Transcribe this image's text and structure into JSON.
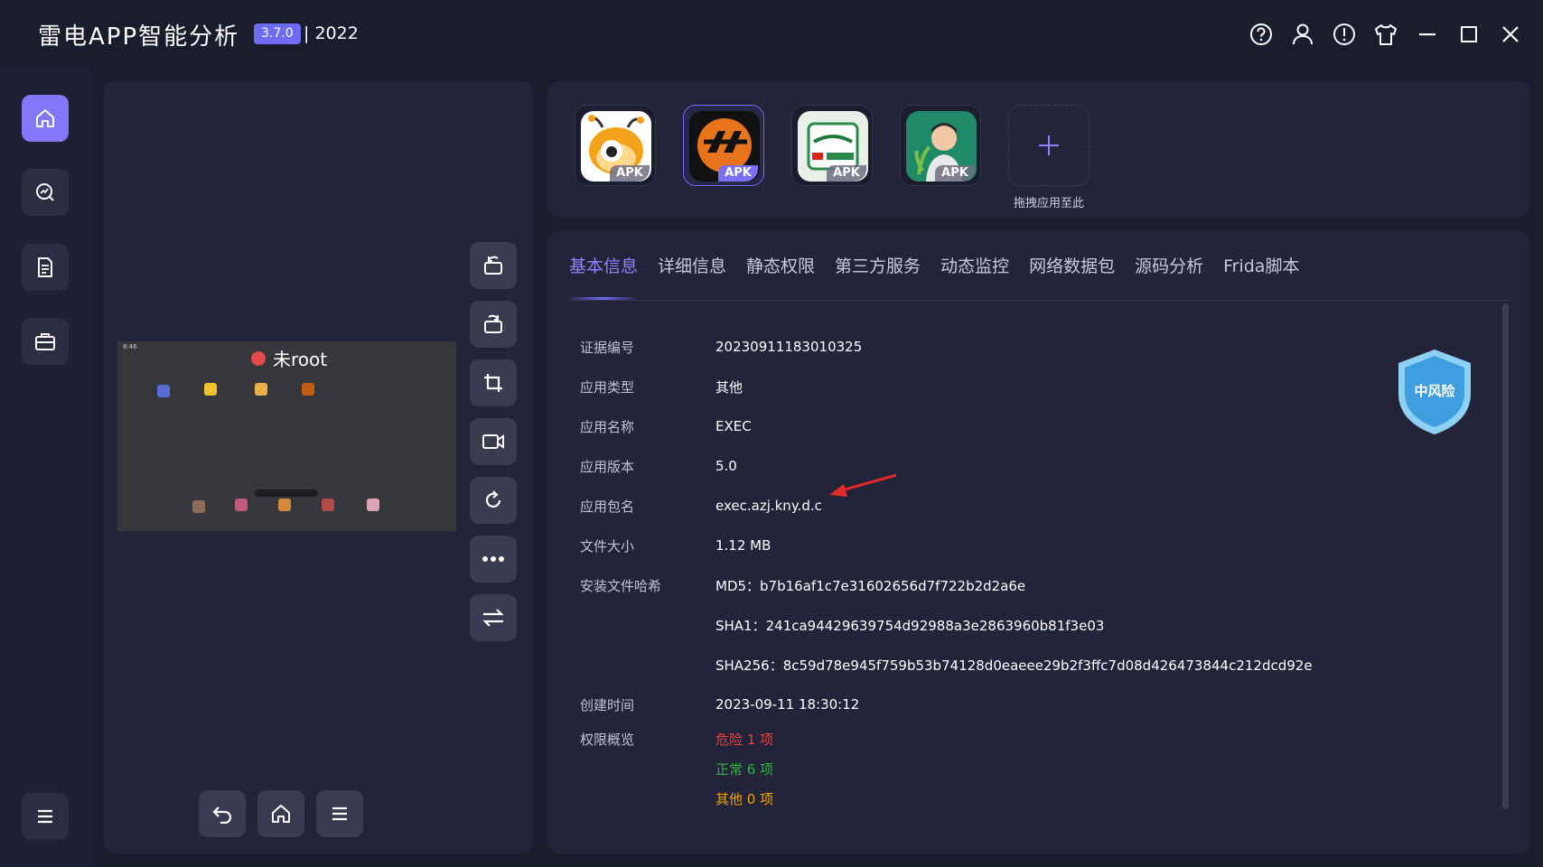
{
  "titlebar": {
    "app_name": "雷电APP智能分析",
    "version": "3.7.0",
    "year": "| 2022",
    "icons": [
      "help-icon",
      "user-icon",
      "alert-icon",
      "shirt-icon",
      "minimize-icon",
      "maximize-icon",
      "close-icon"
    ]
  },
  "sidebar": {
    "items": [
      "home-icon",
      "analytics-icon",
      "document-icon",
      "toolbox-icon"
    ],
    "menu_icon": "menu-icon"
  },
  "device": {
    "root_status": "未root",
    "status_time": "8:46",
    "tools": [
      "rotate-left-icon",
      "rotate-right-icon",
      "crop-icon",
      "record-icon",
      "refresh-icon",
      "more-icon",
      "swap-icon"
    ],
    "nav": [
      "back-icon",
      "home-icon",
      "menu-icon"
    ]
  },
  "apps": {
    "items": [
      {
        "tag": "APK",
        "icon": "ant-mascot-icon"
      },
      {
        "tag": "APK",
        "icon": "exec-logo-icon"
      },
      {
        "tag": "APK",
        "icon": "nutrient-expert-maize-icon"
      },
      {
        "tag": "APK",
        "icon": "man-with-plant-icon"
      }
    ],
    "add_label": "拖拽应用至此"
  },
  "tabs": [
    "基本信息",
    "详细信息",
    "静态权限",
    "第三方服务",
    "动态监控",
    "网络数据包",
    "源码分析",
    "Frida脚本"
  ],
  "info": {
    "cert_label": "证据编号",
    "cert_value": "20230911183010325",
    "type_label": "应用类型",
    "type_value": "其他",
    "name_label": "应用名称",
    "name_value": "EXEC",
    "version_label": "应用版本",
    "version_value": "5.0",
    "package_label": "应用包名",
    "package_value": "exec.azj.kny.d.c",
    "size_label": "文件大小",
    "size_value": "1.12 MB",
    "hash_label": "安装文件哈希",
    "md5": "MD5：b7b16af1c7e31602656d7f722b2d2a6e",
    "sha1": "SHA1：241ca94429639754d92988a3e2863960b81f3e03",
    "sha256": "SHA256：8c59d78e945f759b53b74128d0eaeee29b2f3ffc7d08d426473844c212dcd92e",
    "created_label": "创建时间",
    "created_value": "2023-09-11 18:30:12",
    "perm_label": "权限概览",
    "perm_danger": "危险 1 项",
    "perm_normal": "正常 6 项",
    "perm_other": "其他 0 项"
  },
  "risk": {
    "label": "中风险"
  },
  "colors": {
    "accent": "#6f6bf5",
    "danger": "#e8423f",
    "normal": "#2fb344",
    "other": "#f2a500",
    "shield": "#4aa3e6"
  }
}
